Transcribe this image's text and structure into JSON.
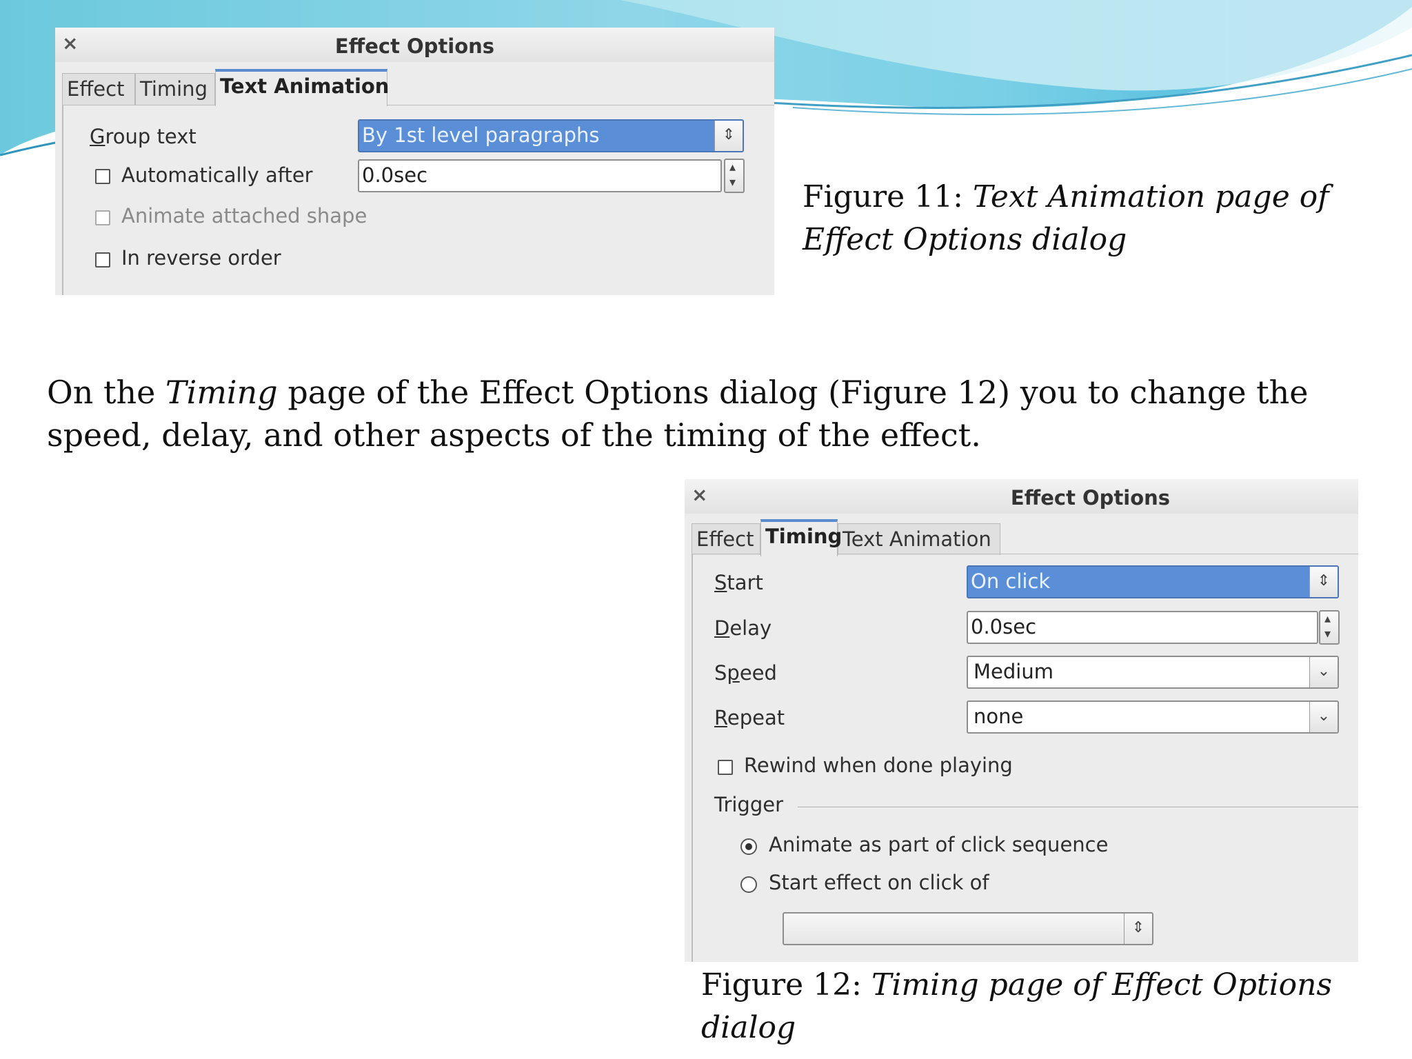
{
  "dialog1": {
    "title": "Effect Options",
    "close_glyph": "×",
    "tabs": [
      "Effect",
      "Timing",
      "Text Animation"
    ],
    "active_tab": "Text Animation",
    "group_text_label": "Group text",
    "group_text_value": "By 1st level paragraphs",
    "auto_after_label": "Automatically after",
    "auto_after_value": "0.0sec",
    "auto_after_checked": false,
    "animate_shape_label": "Animate attached shape",
    "animate_shape_disabled": true,
    "reverse_label": "In reverse order",
    "reverse_checked": false
  },
  "caption1": {
    "prefix": "Figure 11: ",
    "italic": "Text Animation page of Effect Options dialog"
  },
  "paragraph": {
    "part1": "On the ",
    "italic": "Timing",
    "part2": " page of the Effect Options dialog (Figure 12) you to change the speed, delay, and other aspects of the timing of the effect."
  },
  "dialog2": {
    "title": "Effect Options",
    "close_glyph": "×",
    "tabs": [
      "Effect",
      "Timing",
      "Text Animation"
    ],
    "active_tab": "Timing",
    "start_label": "Start",
    "start_value": "On click",
    "delay_label": "Delay",
    "delay_value": "0.0sec",
    "speed_label": "Speed",
    "speed_value": "Medium",
    "repeat_label": "Repeat",
    "repeat_value": "none",
    "rewind_label": "Rewind when done playing",
    "rewind_checked": false,
    "trigger_label": "Trigger",
    "radio1_label": "Animate as part of click sequence",
    "radio1_selected": true,
    "radio2_label": "Start effect on click of",
    "radio2_selected": false,
    "shape_select_value": ""
  },
  "caption2": {
    "prefix": "Figure 12: ",
    "italic": "Timing page of Effect Options dialog"
  },
  "icons": {
    "close": "close-icon",
    "spin": "spin-icon",
    "dropdown": "chevron-down-icon",
    "updown": "up-down-icon"
  },
  "colors": {
    "selection_blue": "#5a8fd8",
    "active_tab_accent": "#5a8ccf",
    "dialog_bg": "#ececec",
    "slide_bg": "#ffffff"
  }
}
